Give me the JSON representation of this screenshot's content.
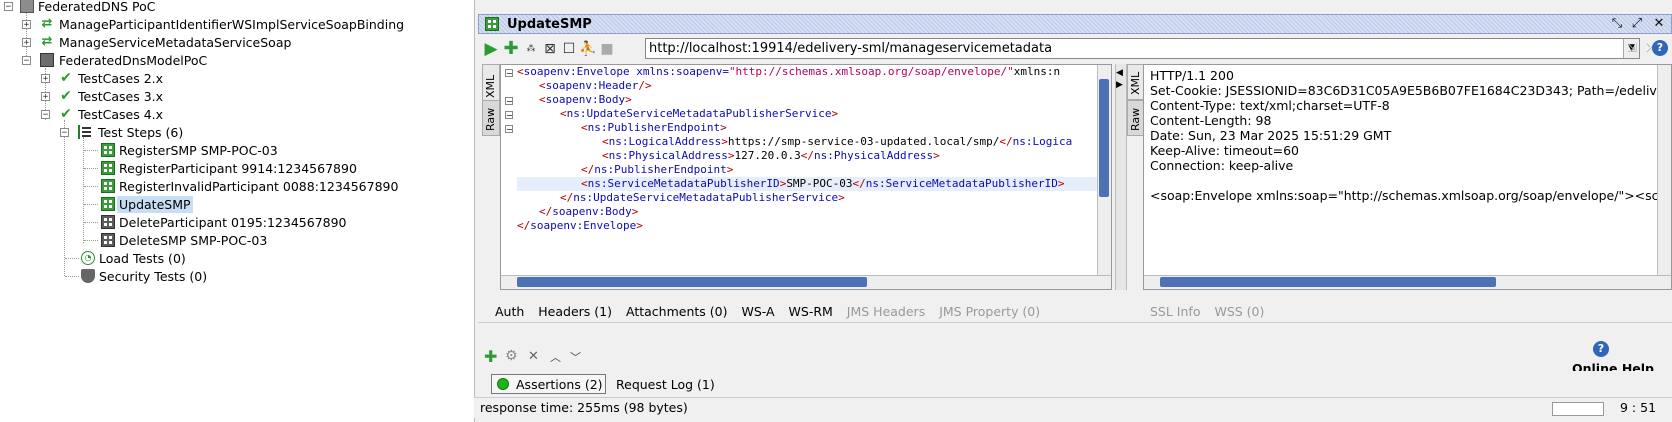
{
  "tree": {
    "root": "FederatedDNS PoC",
    "items": [
      {
        "label": "ManageParticipantIdentifierWSImplServiceSoapBinding"
      },
      {
        "label": "ManageServiceMetadataServiceSoap"
      },
      {
        "label": "FederatedDnsModelPoC"
      },
      {
        "label": "TestCases 2.x"
      },
      {
        "label": "TestCases 3.x"
      },
      {
        "label": "TestCases 4.x"
      },
      {
        "label": "Test Steps (6)"
      },
      {
        "label": "RegisterSMP SMP-POC-03"
      },
      {
        "label": "RegisterParticipant 9914:1234567890"
      },
      {
        "label": "RegisterInvalidParticipant 0088:1234567890"
      },
      {
        "label": "UpdateSMP"
      },
      {
        "label": "DeleteParticipant 0195:1234567890"
      },
      {
        "label": "DeleteSMP SMP-POC-03"
      },
      {
        "label": "Load Tests (0)"
      },
      {
        "label": "Security Tests (0)"
      }
    ]
  },
  "editor": {
    "title": "UpdateSMP",
    "endpoint": "http://localhost:19914/edelivery-sml/manageservicemetadata",
    "request_tab_xml": "XML",
    "request_tab_raw": "Raw",
    "response_tab_xml": "XML",
    "response_tab_raw": "Raw"
  },
  "request_xml": [
    {
      "t": "<soapenv:Envelope xmlns:soapenv=\"http://schemas.xmlsoap.org/soap/envelope/\" xmlns:n"
    },
    {
      "t": "<soapenv:Header/>"
    },
    {
      "t": "<soapenv:Body>"
    },
    {
      "t": "<ns:UpdateServiceMetadataPublisherService>"
    },
    {
      "t": "<ns:PublisherEndpoint>"
    },
    {
      "t": "<ns:LogicalAddress>https://smp-service-03-updated.local/smp/</ns:Logica"
    },
    {
      "t": "<ns:PhysicalAddress>127.20.0.3</ns:PhysicalAddress>"
    },
    {
      "t": "</ns:PublisherEndpoint>"
    },
    {
      "t": "<ns:ServiceMetadataPublisherID>SMP-POC-03</ns:ServiceMetadataPublisherID>"
    },
    {
      "t": "</ns:UpdateServiceMetadataPublisherService>"
    },
    {
      "t": "</soapenv:Body>"
    },
    {
      "t": "</soapenv:Envelope>"
    }
  ],
  "response_lines": [
    "HTTP/1.1 200",
    "Set-Cookie: JSESSIONID=83C6D31C05A9E5B6B07FE1684C23D343; Path=/edelive",
    "Content-Type: text/xml;charset=UTF-8",
    "Content-Length: 98",
    "Date: Sun, 23 Mar 2025 15:51:29 GMT",
    "Keep-Alive: timeout=60",
    "Connection: keep-alive",
    "",
    "<soap:Envelope xmlns:soap=\"http://schemas.xmlsoap.org/soap/envelope/\"><sc"
  ],
  "request_tabs": {
    "auth": "Auth",
    "headers": "Headers (1)",
    "attachments": "Attachments (0)",
    "wsa": "WS-A",
    "wsrm": "WS-RM",
    "jms_headers": "JMS Headers",
    "jms_property": "JMS Property (0)"
  },
  "response_tabs": {
    "ssl": "SSL Info",
    "wss": "WSS (0)"
  },
  "bottom": {
    "assertions": "Assertions (2)",
    "request_log": "Request Log (1)",
    "online_help": "Online Help",
    "response_time": "response time: 255ms (98 bytes)",
    "cursor_pos": "9 : 51"
  },
  "colors": {
    "tag": "#0b0bb5",
    "bracket": "#b00000",
    "value": "#b00060",
    "accent": "#4d72b3",
    "selection": "#c8def4"
  }
}
